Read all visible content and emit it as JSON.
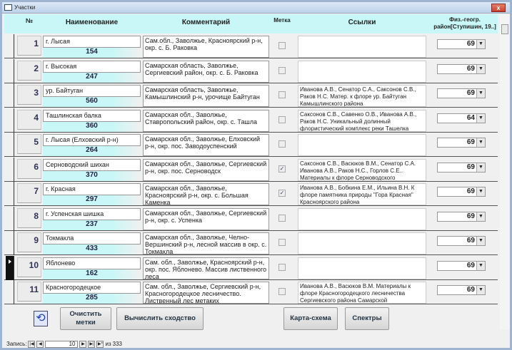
{
  "window": {
    "title": "Участки",
    "close": "x"
  },
  "header": {
    "num": "№",
    "name": "Наименование",
    "comment": "Комментарий",
    "mark": "Метка",
    "links": "Ссылки",
    "region": "Физ.-геогр. район[Ступишин, 19..]"
  },
  "rows": [
    {
      "num": "1",
      "name": "г. Лысая",
      "code": "154",
      "comment": "Сам.обл., Заволжье, Красноярский р-н, окр. с. Б. Раковка",
      "mark": false,
      "links": "",
      "region": "69"
    },
    {
      "num": "2",
      "name": "г. Высокая",
      "code": "247",
      "comment": "Самарская область, Заволжье, Сергиевский район, окр. с. Б. Раковка",
      "mark": false,
      "links": "",
      "region": "69"
    },
    {
      "num": "3",
      "name": "ур. Байтуган",
      "code": "560",
      "comment": "Самарская область, Заволжье, Камышлинский р-н, урочище Байтуган",
      "mark": false,
      "links": "Иванова А.В., Сенатор С.А., Саксонов С.В., Раков Н.С. Матер. к флоре ур. Байтуган Камышлинского района",
      "region": "69"
    },
    {
      "num": "4",
      "name": "Ташлинская балка",
      "code": "360",
      "comment": "Самарская обл., Заволжье, Ставропольский район, окр. с. Ташла",
      "mark": false,
      "links": "Саксонов С.В., Савенко О.В., Иванова А.В., Раков Н.С. Уникальный долинный флористический комплекс реки Ташелка",
      "region": "64"
    },
    {
      "num": "5",
      "name": "г. Лысая (Елховский р-н)",
      "code": "264",
      "comment": "Самарская обл., Заволжье, Елховский р-н, окр. пос. Заводоуспенский",
      "mark": false,
      "links": "",
      "region": "69"
    },
    {
      "num": "6",
      "name": "Серноводский шихан",
      "code": "370",
      "comment": "Самарская обл., Заволжье, Сергиевский р-н, окр. пос. Серноводск",
      "mark": true,
      "links": "Саксонов С.В., Васюков В.М., Сенатор С.А. Иванова А.В., Раков Н.С., Горлов С.Е.. Материалы к флоре Серноводского",
      "region": "69"
    },
    {
      "num": "7",
      "name": "г. Красная",
      "code": "297",
      "comment": "Самарская обл., Заволжье, Красноярский р-н, окр. с. Большая Каменка",
      "mark": true,
      "links": "Иванова А.В., Бобкина Е.М., Ильина В.Н. К флоре памятника природы \"Гора Красная\" Красноярского района",
      "region": "69"
    },
    {
      "num": "8",
      "name": "г. Успенская шишка",
      "code": "237",
      "comment": "Самарская обл., Заволжье, Сергиевский р-н, окр. с. Успенка",
      "mark": false,
      "links": "",
      "region": "69"
    },
    {
      "num": "9",
      "name": "Токмакла",
      "code": "433",
      "comment": "Самарская обл., Заволжье, Челно-Вершинский р-н, лесной массив в окр. с. Токмакла",
      "mark": false,
      "links": "",
      "region": "69"
    },
    {
      "num": "10",
      "name": "Яблонево",
      "code": "162",
      "comment": "Сам. обл., Заволжье, Красноярский р-н, окр. пос. Яблонево. Массив лиственного леса",
      "mark": false,
      "links": "",
      "region": "69",
      "current": true
    },
    {
      "num": "11",
      "name": "Красногородецкое",
      "code": "285",
      "comment": "Сам. обл., Заволжье, Сергиевский р-н, Красногородецкое лесничество. Лиственный лес метаких",
      "mark": false,
      "links": "Иванова А.В., Васюков В.М. Материалы к флоре Красногородецкого лесничества Сергиевского района Самарской",
      "region": "69"
    }
  ],
  "buttons": {
    "clear": "Очистить метки",
    "compute": "Вычислить сходство",
    "map": "Карта-схема",
    "spectra": "Спектры"
  },
  "nav": {
    "label": "Запись:",
    "current": "10",
    "of": "из",
    "total": "333"
  }
}
